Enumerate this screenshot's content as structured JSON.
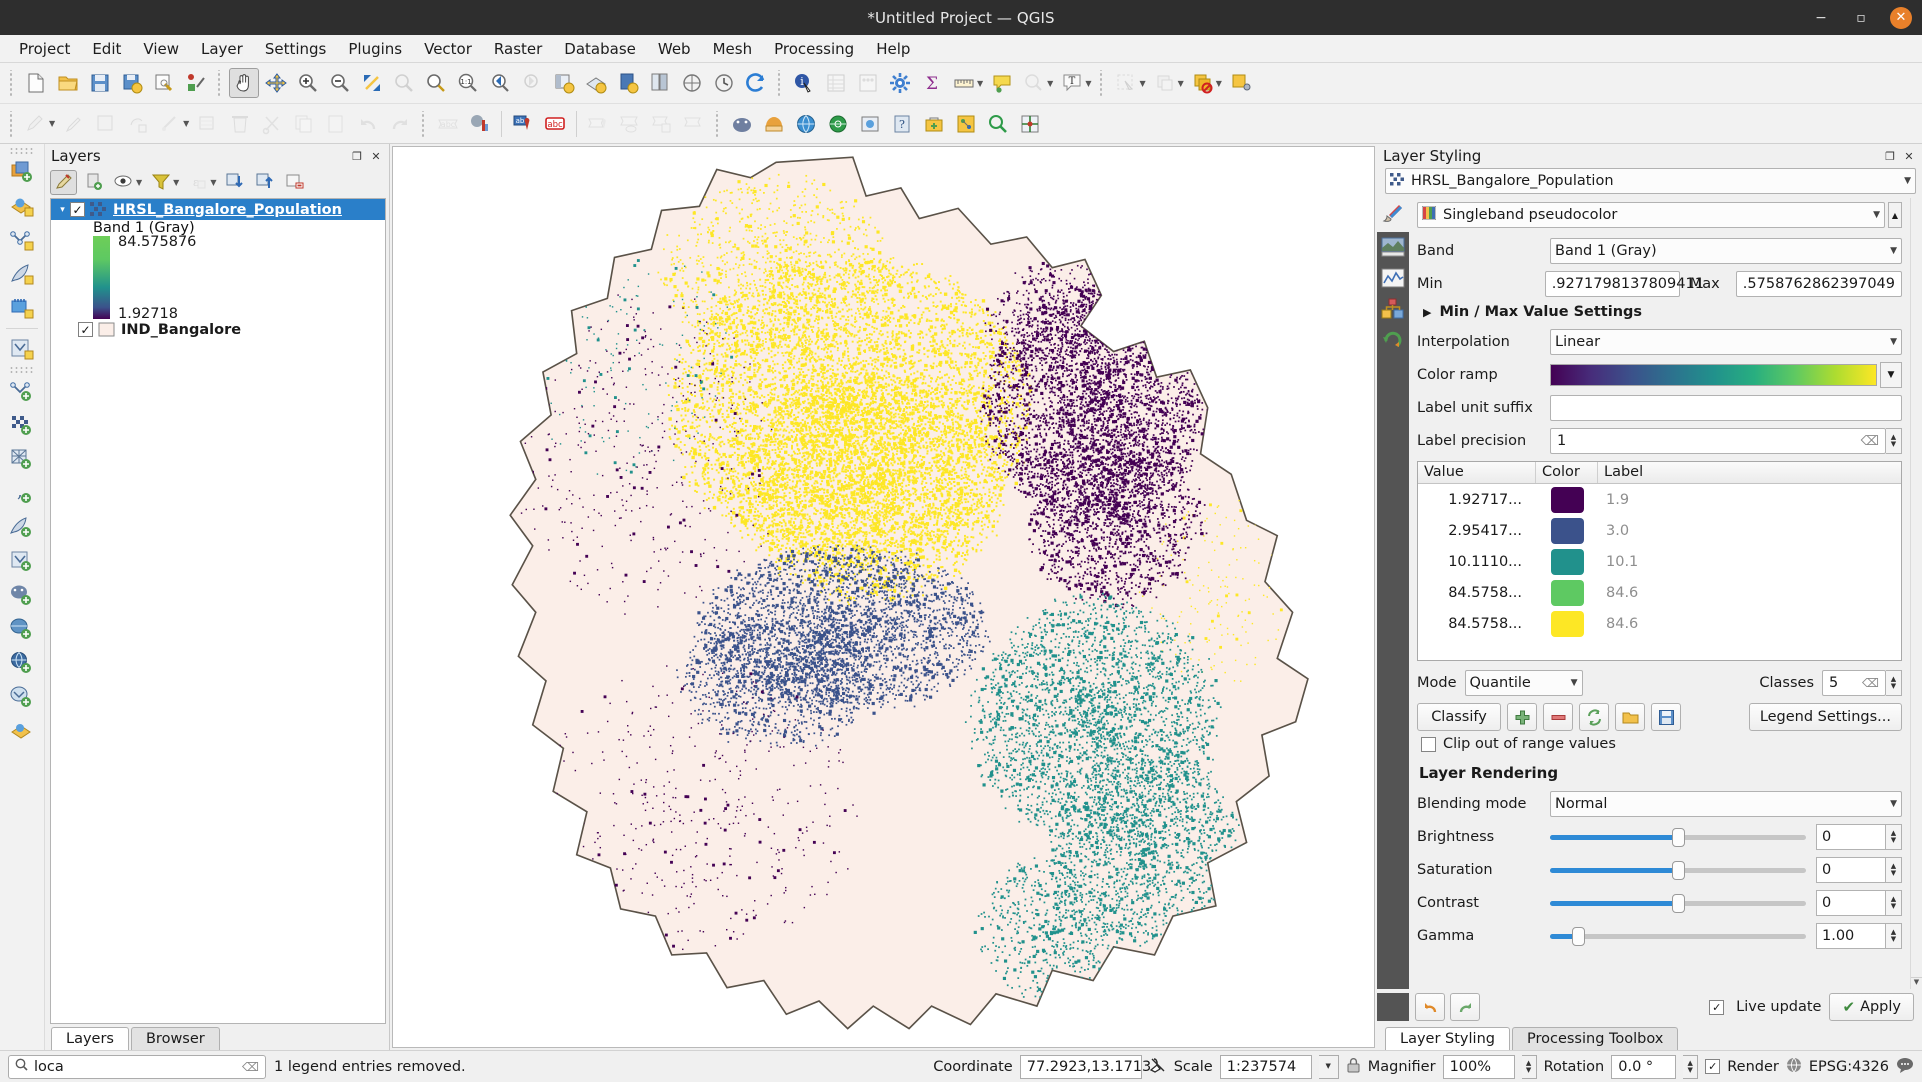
{
  "window": {
    "title": "*Untitled Project — QGIS",
    "minimize_label": "−",
    "maximize_label": "▫",
    "close_label": "✕"
  },
  "menubar": {
    "items": [
      "Project",
      "Edit",
      "View",
      "Layer",
      "Settings",
      "Plugins",
      "Vector",
      "Raster",
      "Database",
      "Web",
      "Mesh",
      "Processing",
      "Help"
    ]
  },
  "layers_panel": {
    "title": "Layers",
    "float_label": "❐",
    "close_label": "✕",
    "tree": {
      "raster_layer": {
        "name": "HRSL_Bangalore_Population",
        "checked": "✓",
        "expander": "▾",
        "band_label": "Band 1 (Gray)",
        "ramp_max": "84.575876",
        "ramp_min": "1.92718"
      },
      "vector_layer": {
        "name": "IND_Bangalore",
        "checked": "✓"
      }
    },
    "tabs": [
      {
        "label": "Layers",
        "active": true
      },
      {
        "label": "Browser",
        "active": false
      }
    ]
  },
  "layer_styling": {
    "title": "Layer Styling",
    "float_label": "❐",
    "close_label": "✕",
    "layer_selected": "HRSL_Bangalore_Population",
    "renderer": "Singleband pseudocolor",
    "band_label": "Band",
    "band_value": "Band 1 (Gray)",
    "min_label": "Min",
    "min_value": ".9271798137809411",
    "max_label": "Max",
    "max_value": ".5758762862397049",
    "minmax_settings": "Min / Max Value Settings",
    "minmax_tri": "▶",
    "interpolation_label": "Interpolation",
    "interpolation_value": "Linear",
    "color_ramp_label": "Color ramp",
    "label_unit_suffix_label": "Label unit suffix",
    "label_unit_suffix_value": "",
    "label_precision_label": "Label precision",
    "label_precision_value": "1",
    "table": {
      "headers": [
        "Value",
        "Color",
        "Label"
      ],
      "rows": [
        {
          "value": "1.92717...",
          "color": "#440154",
          "label": "1.9"
        },
        {
          "value": "2.95417...",
          "color": "#3b528b",
          "label": "3.0"
        },
        {
          "value": "10.1110...",
          "color": "#21918c",
          "label": "10.1"
        },
        {
          "value": "84.5758...",
          "color": "#5ec962",
          "label": "84.6"
        },
        {
          "value": "84.5758...",
          "color": "#fde725",
          "label": "84.6"
        }
      ]
    },
    "mode_label": "Mode",
    "mode_value": "Quantile",
    "classes_label": "Classes",
    "classes_value": "5",
    "classify_label": "Classify",
    "legend_settings_label": "Legend Settings...",
    "clip_label": "Clip out of range values",
    "clip_checked": false,
    "rendering_title": "Layer Rendering",
    "blending_label": "Blending mode",
    "blending_value": "Normal",
    "sliders": [
      {
        "label": "Brightness",
        "value": "0",
        "pct": 50
      },
      {
        "label": "Saturation",
        "value": "0",
        "pct": 50
      },
      {
        "label": "Contrast",
        "value": "0",
        "pct": 50
      },
      {
        "label": "Gamma",
        "value": "1.00",
        "pct": 11
      }
    ],
    "live_update_label": "Live update",
    "live_update_checked": "✓",
    "apply_label": "Apply",
    "tabs": [
      {
        "label": "Layer Styling",
        "active": true
      },
      {
        "label": "Processing Toolbox",
        "active": false
      }
    ]
  },
  "statusbar": {
    "search_value": "loca",
    "search_placeholder": "Search",
    "message": "1 legend entries removed.",
    "coordinate_label": "Coordinate",
    "coordinate_value": "77.2923,13.1713",
    "scale_label": "Scale",
    "scale_value": "1:237574",
    "magnifier_label": "Magnifier",
    "magnifier_value": "100%",
    "rotation_label": "Rotation",
    "rotation_value": "0.0 °",
    "render_label": "Render",
    "render_checked": "✓",
    "crs_label": "EPSG:4326"
  },
  "map": {
    "boundary_fill": "#fbeee8",
    "boundary_stroke": "#5a5248",
    "background": "#ffffff",
    "cluster_colors": {
      "yellow": "#fde725",
      "purple": "#440154",
      "blue": "#3b528b",
      "teal": "#21918c"
    }
  },
  "colors": {
    "accent": "#2a7fc9",
    "dock_icon_bar": "#545454",
    "titlebar": "#2e2e2e",
    "close_button": "#e8802a"
  }
}
